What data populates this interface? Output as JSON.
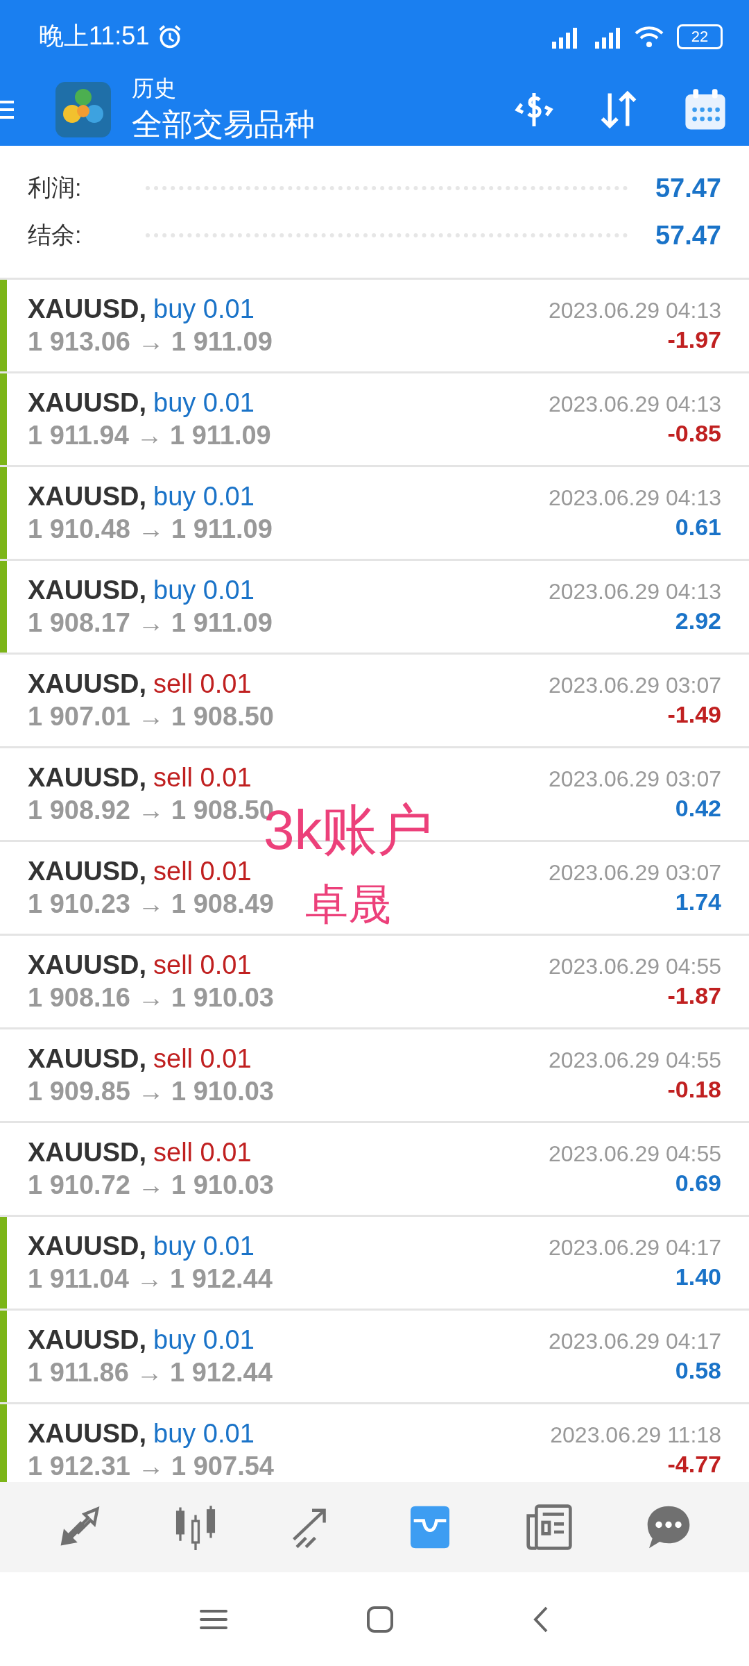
{
  "status_bar": {
    "time": "晚上11:51",
    "battery": "22"
  },
  "header": {
    "title": "历史",
    "subtitle": "全部交易品种"
  },
  "summary": [
    {
      "label": "利润:",
      "value": "57.47"
    },
    {
      "label": "结余:",
      "value": "57.47"
    }
  ],
  "trades": [
    {
      "kind": "buy",
      "symbol": "XAUUSD,",
      "order": "buy 0.01",
      "prices": "1 913.06 → 1 911.09",
      "time": "2023.06.29 04:13",
      "profit": {
        "kind": "loss",
        "text": "-1.97"
      }
    },
    {
      "kind": "buy",
      "symbol": "XAUUSD,",
      "order": "buy 0.01",
      "prices": "1 911.94 → 1 911.09",
      "time": "2023.06.29 04:13",
      "profit": {
        "kind": "loss",
        "text": "-0.85"
      }
    },
    {
      "kind": "buy",
      "symbol": "XAUUSD,",
      "order": "buy 0.01",
      "prices": "1 910.48 → 1 911.09",
      "time": "2023.06.29 04:13",
      "profit": {
        "kind": "gain",
        "text": "0.61"
      }
    },
    {
      "kind": "buy",
      "symbol": "XAUUSD,",
      "order": "buy 0.01",
      "prices": "1 908.17 → 1 911.09",
      "time": "2023.06.29 04:13",
      "profit": {
        "kind": "gain",
        "text": "2.92"
      }
    },
    {
      "kind": "sell",
      "symbol": "XAUUSD,",
      "order": "sell 0.01",
      "prices": "1 907.01 → 1 908.50",
      "time": "2023.06.29 03:07",
      "profit": {
        "kind": "loss",
        "text": "-1.49"
      }
    },
    {
      "kind": "sell",
      "symbol": "XAUUSD,",
      "order": "sell 0.01",
      "prices": "1 908.92 → 1 908.50",
      "time": "2023.06.29 03:07",
      "profit": {
        "kind": "gain",
        "text": "0.42"
      }
    },
    {
      "kind": "sell",
      "symbol": "XAUUSD,",
      "order": "sell 0.01",
      "prices": "1 910.23 → 1 908.49",
      "time": "2023.06.29 03:07",
      "profit": {
        "kind": "gain",
        "text": "1.74"
      }
    },
    {
      "kind": "sell",
      "symbol": "XAUUSD,",
      "order": "sell 0.01",
      "prices": "1 908.16 → 1 910.03",
      "time": "2023.06.29 04:55",
      "profit": {
        "kind": "loss",
        "text": "-1.87"
      }
    },
    {
      "kind": "sell",
      "symbol": "XAUUSD,",
      "order": "sell 0.01",
      "prices": "1 909.85 → 1 910.03",
      "time": "2023.06.29 04:55",
      "profit": {
        "kind": "loss",
        "text": "-0.18"
      }
    },
    {
      "kind": "sell",
      "symbol": "XAUUSD,",
      "order": "sell 0.01",
      "prices": "1 910.72 → 1 910.03",
      "time": "2023.06.29 04:55",
      "profit": {
        "kind": "gain",
        "text": "0.69"
      }
    },
    {
      "kind": "buy",
      "symbol": "XAUUSD,",
      "order": "buy 0.01",
      "prices": "1 911.04 → 1 912.44",
      "time": "2023.06.29 04:17",
      "profit": {
        "kind": "gain",
        "text": "1.40"
      }
    },
    {
      "kind": "buy",
      "symbol": "XAUUSD,",
      "order": "buy 0.01",
      "prices": "1 911.86 → 1 912.44",
      "time": "2023.06.29 04:17",
      "profit": {
        "kind": "gain",
        "text": "0.58"
      }
    },
    {
      "kind": "buy",
      "symbol": "XAUUSD,",
      "order": "buy 0.01",
      "prices": "1 912.31 → 1 907.54",
      "time": "2023.06.29 11:18",
      "profit": {
        "kind": "loss",
        "text": "-4.77"
      }
    }
  ],
  "annotation": [
    "3k账户",
    "卓晟"
  ],
  "bottom_nav": [
    {
      "kind": "quotes",
      "selected": false
    },
    {
      "kind": "chart",
      "selected": false
    },
    {
      "kind": "trade",
      "selected": false
    },
    {
      "kind": "history",
      "selected": true
    },
    {
      "kind": "news",
      "selected": false
    },
    {
      "kind": "chat",
      "selected": false
    }
  ]
}
